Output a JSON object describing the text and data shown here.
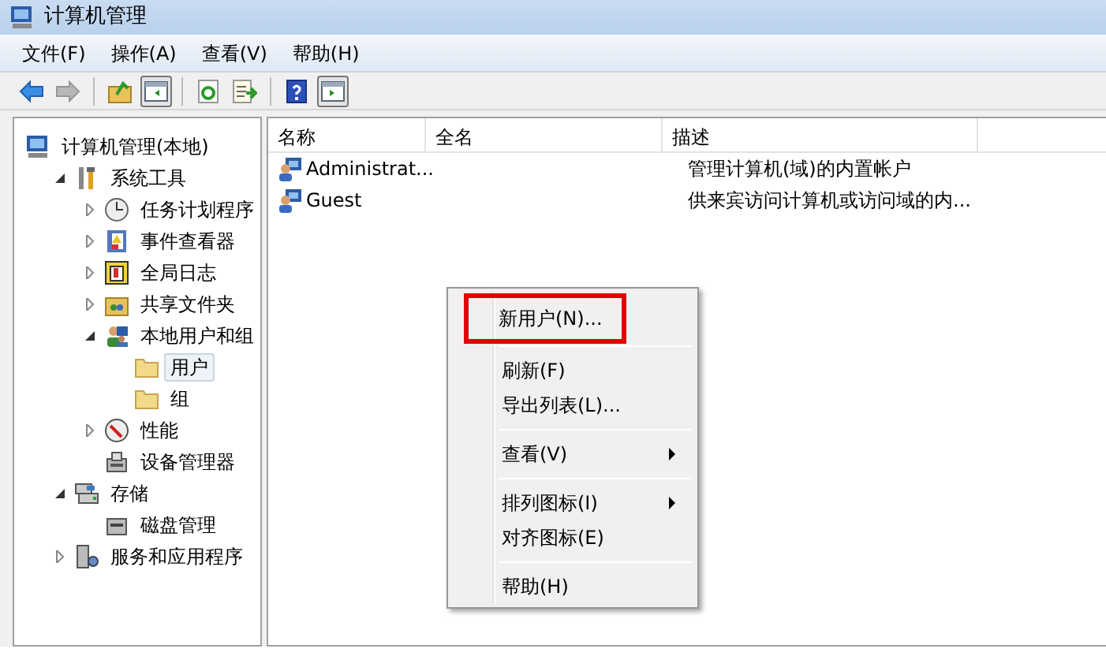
{
  "window": {
    "title": "计算机管理"
  },
  "menu": [
    "文件(F)",
    "操作(A)",
    "查看(V)",
    "帮助(H)"
  ],
  "toolbar": [
    {
      "kind": "button",
      "pressed": false,
      "disabled": false
    },
    {
      "kind": "button",
      "pressed": false,
      "disabled": true
    },
    {
      "kind": "separator"
    },
    {
      "kind": "button",
      "pressed": false,
      "disabled": false
    },
    {
      "kind": "button",
      "pressed": true,
      "disabled": false
    },
    {
      "kind": "separator"
    },
    {
      "kind": "button",
      "pressed": false,
      "disabled": false
    },
    {
      "kind": "button",
      "pressed": false,
      "disabled": false
    },
    {
      "kind": "separator"
    },
    {
      "kind": "button",
      "pressed": false,
      "disabled": false
    },
    {
      "kind": "button",
      "pressed": true,
      "disabled": false
    }
  ],
  "tree": [
    {
      "label": "计算机管理(本地)",
      "selected": false,
      "children": [
        {
          "label": "系统工具",
          "expanded": true,
          "selected": false,
          "children": [
            {
              "label": "任务计划程序",
              "expanded": false,
              "selected": false
            },
            {
              "label": "事件查看器",
              "expanded": false,
              "selected": false
            },
            {
              "label": "全局日志",
              "expanded": false,
              "selected": false
            },
            {
              "label": "共享文件夹",
              "expanded": false,
              "selected": false
            },
            {
              "label": "本地用户和组",
              "expanded": true,
              "selected": false,
              "children": [
                {
                  "label": "用户",
                  "selected": true
                },
                {
                  "label": "组",
                  "selected": false
                }
              ]
            },
            {
              "label": "性能",
              "expanded": false,
              "selected": false
            },
            {
              "label": "设备管理器",
              "selected": false
            }
          ]
        },
        {
          "label": "存储",
          "expanded": true,
          "selected": false,
          "children": [
            {
              "label": "磁盘管理",
              "selected": false
            }
          ]
        },
        {
          "label": "服务和应用程序",
          "expanded": false,
          "selected": false
        }
      ]
    }
  ],
  "table": {
    "columns": [
      "名称",
      "全名",
      "描述"
    ],
    "rows": [
      {
        "name": "Administrat...",
        "description": "管理计算机(域)的内置帐户"
      },
      {
        "name": "Guest",
        "description": "供来宾访问计算机或访问域的内..."
      }
    ]
  },
  "context_menu": [
    {
      "kind": "item",
      "label": "新用户(N)...",
      "submenu": false,
      "highlighted": true
    },
    {
      "kind": "separator"
    },
    {
      "kind": "item",
      "label": "刷新(F)",
      "submenu": false,
      "highlighted": false
    },
    {
      "kind": "item",
      "label": "导出列表(L)...",
      "submenu": false,
      "highlighted": false
    },
    {
      "kind": "separator"
    },
    {
      "kind": "item",
      "label": "查看(V)",
      "submenu": true,
      "highlighted": false
    },
    {
      "kind": "separator"
    },
    {
      "kind": "item",
      "label": "排列图标(I)",
      "submenu": true,
      "highlighted": false
    },
    {
      "kind": "item",
      "label": "对齐图标(E)",
      "submenu": false,
      "highlighted": false
    },
    {
      "kind": "separator"
    },
    {
      "kind": "item",
      "label": "帮助(H)",
      "submenu": false,
      "highlighted": false
    }
  ]
}
